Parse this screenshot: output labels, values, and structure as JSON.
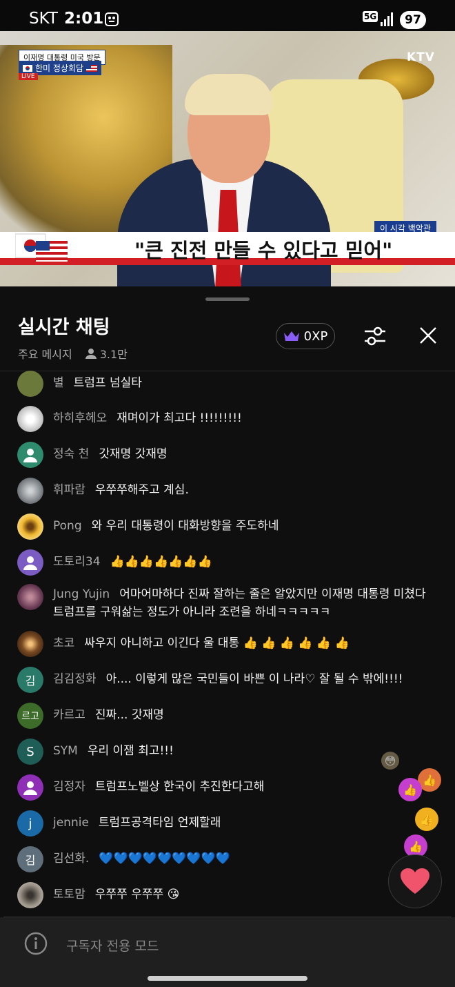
{
  "status_bar": {
    "carrier": "SKT",
    "time": "2:01",
    "network": "5G",
    "battery": "97"
  },
  "video": {
    "badge_line1": "이재명 대통령 미국 방문",
    "badge_line2": "한미 정상회담",
    "live_label": "LIVE",
    "channel": "KTV",
    "lower_tag": "이 시각 백악관",
    "caption": "\"큰 진전 만들 수 있다고 믿어\""
  },
  "chat_header": {
    "title": "실시간 채팅",
    "mode": "주요 메시지",
    "viewers": "3.1만",
    "xp": "0XP"
  },
  "messages": [
    {
      "author": "별",
      "text": "트럼프 넘실타",
      "avatar": {
        "type": "image",
        "color": "#6b7a3a"
      }
    },
    {
      "author": "하히후헤오",
      "text": "재며이가 최고다 !!!!!!!!!",
      "avatar": {
        "type": "image",
        "color": "#e8e8e8"
      }
    },
    {
      "author": "정숙 천",
      "text": "갓재명 갓재명",
      "avatar": {
        "type": "person",
        "color": "#2e8b6e"
      }
    },
    {
      "author": "휘파람",
      "text": "우쭈쭈해주고 계심.",
      "avatar": {
        "type": "image",
        "color": "#8b8f93"
      }
    },
    {
      "author": "Pong",
      "text": "와 우리 대통령이 대화방향을 주도하네",
      "avatar": {
        "type": "image",
        "color": "#e6b93a"
      }
    },
    {
      "author": "도토리34",
      "text": "👍👍👍👍👍👍👍",
      "avatar": {
        "type": "person",
        "color": "#7b5cc2"
      }
    },
    {
      "author": "Jung Yujin",
      "text": "어마어마하다 진짜 잘하는 줄은 알았지만 이재명 대통령 미쳤다 트럼프를 구워삶는 정도가 아니라 조련을 하네ㅋㅋㅋㅋㅋ",
      "avatar": {
        "type": "image",
        "color": "#6a3b55"
      }
    },
    {
      "author": "초코",
      "text": "싸우지 아니하고 이긴다 울 대통 👍 👍 👍 👍 👍 👍",
      "avatar": {
        "type": "image",
        "color": "#5a3a22"
      }
    },
    {
      "author": "김김정화",
      "text": "아.... 이렇게 많은 국민들이 바쁜 이 나라♡ 잘 될 수 밖에!!!!",
      "avatar": {
        "type": "letter",
        "letter": "김",
        "color": "#2a7a6a"
      }
    },
    {
      "author": "카르고",
      "text": "진짜... 갓재명",
      "avatar": {
        "type": "letter",
        "letter": "르고",
        "color": "#3d6b2a"
      }
    },
    {
      "author": "SYM",
      "text": "우리 이잼 최고!!!",
      "avatar": {
        "type": "letter",
        "letter": "S",
        "color": "#1f5e56"
      }
    },
    {
      "author": "김정자",
      "text": "트럼프노벨상 한국이 추진한다고해",
      "avatar": {
        "type": "person",
        "color": "#8e2fb5"
      }
    },
    {
      "author": "jennie",
      "text": "트럼프공격타임 언제할래",
      "avatar": {
        "type": "letter",
        "letter": "j",
        "color": "#1a6aa8"
      }
    },
    {
      "author": "김선화.",
      "text": "💙💙💙💙💙💙💙💙💙",
      "avatar": {
        "type": "letter",
        "letter": "김",
        "color": "#5e6e7a"
      }
    },
    {
      "author": "토토맘",
      "text": "우쭈쭈 우쭈쭈 😘",
      "avatar": {
        "type": "image",
        "color": "#9a9286"
      }
    }
  ],
  "footer": {
    "placeholder": "구독자 전용 모드"
  },
  "icons": {
    "xp": "crown-icon",
    "filter": "sliders-icon",
    "close": "close-icon",
    "viewers": "person-icon",
    "info": "info-icon",
    "heart": "heart-icon"
  },
  "colors": {
    "background": "#0f0f0f",
    "heart": "#f0546c",
    "xp_crown": "#8a5cf6",
    "caption_red": "#d21e25"
  }
}
